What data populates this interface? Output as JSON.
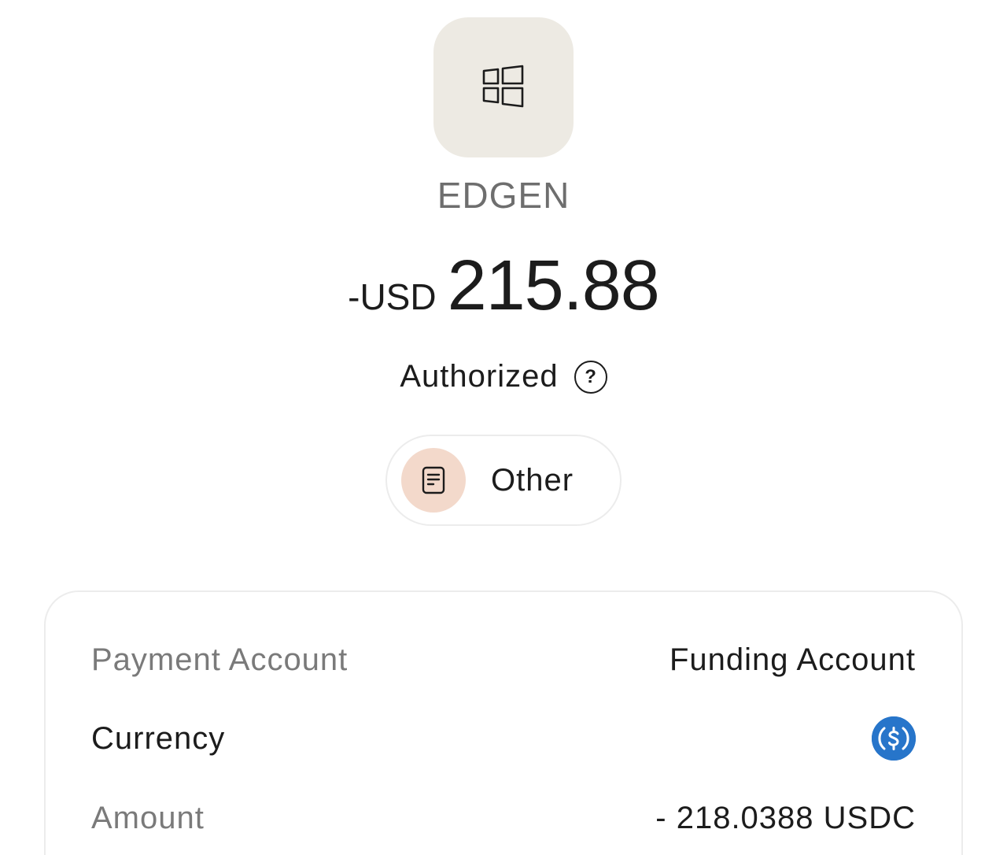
{
  "merchant": {
    "icon": "windows-logo-icon",
    "name": "EDGEN"
  },
  "transaction": {
    "currency_prefix": "-USD",
    "amount": "215.88",
    "status": "Authorized",
    "status_help_icon": "question-circle-icon"
  },
  "category": {
    "icon": "receipt-icon",
    "label": "Other",
    "icon_bg_color": "#f3d9cb"
  },
  "details": {
    "payment_account": {
      "label": "Payment Account",
      "value": "Funding Account"
    },
    "currency": {
      "label": "Currency",
      "icon": "usdc-coin-icon",
      "icon_color": "#2775ca"
    },
    "amount": {
      "label": "Amount",
      "value": "- 218.0388 USDC"
    }
  }
}
